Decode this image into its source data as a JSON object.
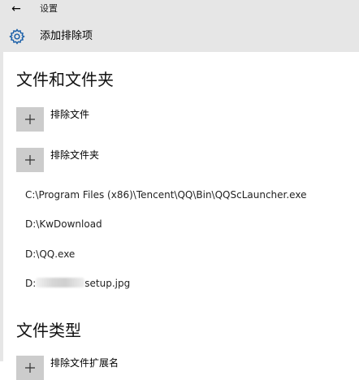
{
  "header": {
    "back_icon": "arrow-left-icon",
    "app_title": "设置",
    "page_icon": "gear-icon",
    "page_title": "添加排除项"
  },
  "sections": {
    "files_folders_title": "文件和文件夹",
    "file_types_title": "文件类型"
  },
  "actions": {
    "exclude_file_label": "排除文件",
    "exclude_folder_label": "排除文件夹",
    "exclude_file_type_label": "排除文件扩展名",
    "plus_icon": "plus-icon"
  },
  "excluded_items": [
    "C:\\Program Files (x86)\\Tencent\\QQ\\Bin\\QQScLauncher.exe",
    "D:\\KwDownload",
    "D:\\QQ.exe"
  ],
  "redacted_item": {
    "prefix": "D:",
    "suffix": "setup.jpg"
  },
  "colors": {
    "header_bg": "#e6e6e6",
    "button_bg": "#cccccc",
    "accent_icon": "#1a5fa8"
  }
}
